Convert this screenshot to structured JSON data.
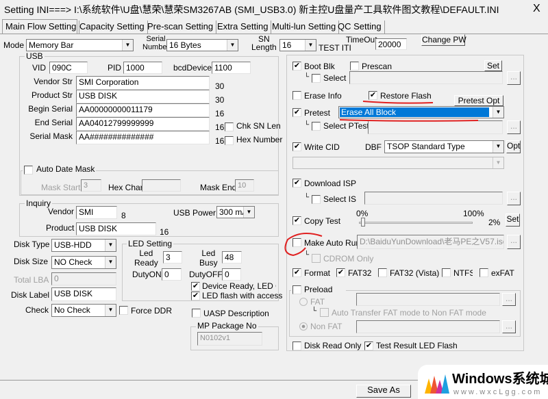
{
  "window": {
    "title": "Setting  INI===> I:\\系统软件\\U盘\\慧荣\\慧荣SM3267AB  (SMI_USB3.0)  新主控U盘量产工具软件图文教程\\DEFAULT.INI",
    "close": "X"
  },
  "tabs": [
    "Main Flow Setting",
    "Capacity Setting",
    "Pre-scan Setting",
    "Extra Setting",
    "Multi-lun Setting",
    "QC Setting"
  ],
  "top": {
    "mode_label": "Mode",
    "mode_value": "Memory Bar",
    "serial_label_1": "Serial",
    "serial_label_2": "Number",
    "serial_value": "16 Bytes",
    "sn_label_1": "SN",
    "sn_label_2": "Length",
    "sn_value": "16",
    "test_label": "TEST ITI",
    "timeout_label": "TimeOut",
    "timeout_value": "20000",
    "change_pw": "Change PW"
  },
  "usb": {
    "title": "USB",
    "vid_label": "VID",
    "vid": "090C",
    "pid_label": "PID",
    "pid": "1000",
    "bcd_label": "bcdDevice",
    "bcd": "1100",
    "rows": [
      {
        "label": "Vendor Str",
        "value": "SMI Corporation",
        "len": "30"
      },
      {
        "label": "Product Str",
        "value": "USB DISK",
        "len": "30"
      },
      {
        "label": "Begin Serial",
        "value": "AA00000000011179",
        "len": "16"
      },
      {
        "label": "End Serial",
        "value": "AA04012799999999",
        "len": "16"
      },
      {
        "label": "Serial Mask",
        "value": "AA##############",
        "len": "16"
      }
    ],
    "chk_sn_len": "Chk SN Len",
    "hex_number": "Hex Number",
    "auto_date_mask": "Auto Date Mask",
    "mask_start_label": "Mask Start",
    "mask_start": "3",
    "hex_char_label": "Hex Char:",
    "hex_char": "",
    "mask_end_label": "Mask End",
    "mask_end": "10"
  },
  "inquiry": {
    "title": "Inquiry",
    "vendor_label": "Vendor",
    "vendor": "SMI",
    "vendor_len": "8",
    "product_label": "Product",
    "product": "USB DISK",
    "product_len": "16",
    "usb_power_label": "USB Power",
    "usb_power": "300 mA"
  },
  "disk": {
    "type_label": "Disk Type",
    "type": "USB-HDD",
    "size_label": "Disk Size",
    "size": "NO Check",
    "lba_label": "Total LBA",
    "lba": "0",
    "label_label": "Disk Label",
    "label": "USB DISK",
    "check_label": "Check",
    "check": "No Check",
    "force_ddr": "Force DDR"
  },
  "led": {
    "title": "LED Setting",
    "ready_1": "Led",
    "ready_2": "Ready",
    "ready": "3",
    "busy_1": "Led",
    "busy_2": "Busy",
    "busy": "48",
    "duty_on_label": "DutyON",
    "duty_on": "0",
    "duty_off_label": "DutyOFF",
    "duty_off": "0",
    "device_ready": "Device Ready, LED Off",
    "flash_access": "LED flash with access"
  },
  "uasp": "UASP Description",
  "mp": {
    "title": "MP Package No",
    "value": "N0102v1"
  },
  "right": {
    "boot_blk": "Boot Blk",
    "prescan": "Prescan",
    "set": "Set",
    "select": "Select",
    "browse": "...",
    "erase_info": "Erase Info",
    "restore_flash": "Restore Flash",
    "pretest_opt": "Pretest Opt",
    "pretest": "Pretest",
    "pretest_value": "Erase All Block",
    "select_ptest": "Select PTest",
    "write_cid": "Write CID",
    "dbf_label": "DBF",
    "dbf_value": "TSOP Standard Type",
    "opt": "Opt",
    "download_isp": "Download ISP",
    "select_isp": "Select ISP",
    "copy_test": "Copy Test",
    "pct_min": "0%",
    "pct_max": "100%",
    "copy_pct": "2%",
    "copy_value": 2,
    "make_auto_run": "Make Auto Run",
    "auto_run_path": "D:\\BaiduYunDownload\\老马PE之V57.iso",
    "cdrom_only": "CDROM Only",
    "format": "Format",
    "fat32": "FAT32",
    "fat32_vista": "FAT32 (Vista)",
    "ntfs": "NTFS",
    "exfat": "exFAT",
    "preload": "Preload",
    "fat": "FAT",
    "auto_transfer": "Auto Transfer FAT mode to Non FAT mode",
    "non_fat": "Non FAT",
    "disk_read_only": "Disk Read Only",
    "test_led": "Test Result LED Flash"
  },
  "save_as": "Save  As",
  "watermark": {
    "brand": "Windows系统城",
    "url": "www.wxcLgg.com"
  },
  "colors": {
    "highlight": "#0078d7",
    "annotation": "#e02020"
  }
}
